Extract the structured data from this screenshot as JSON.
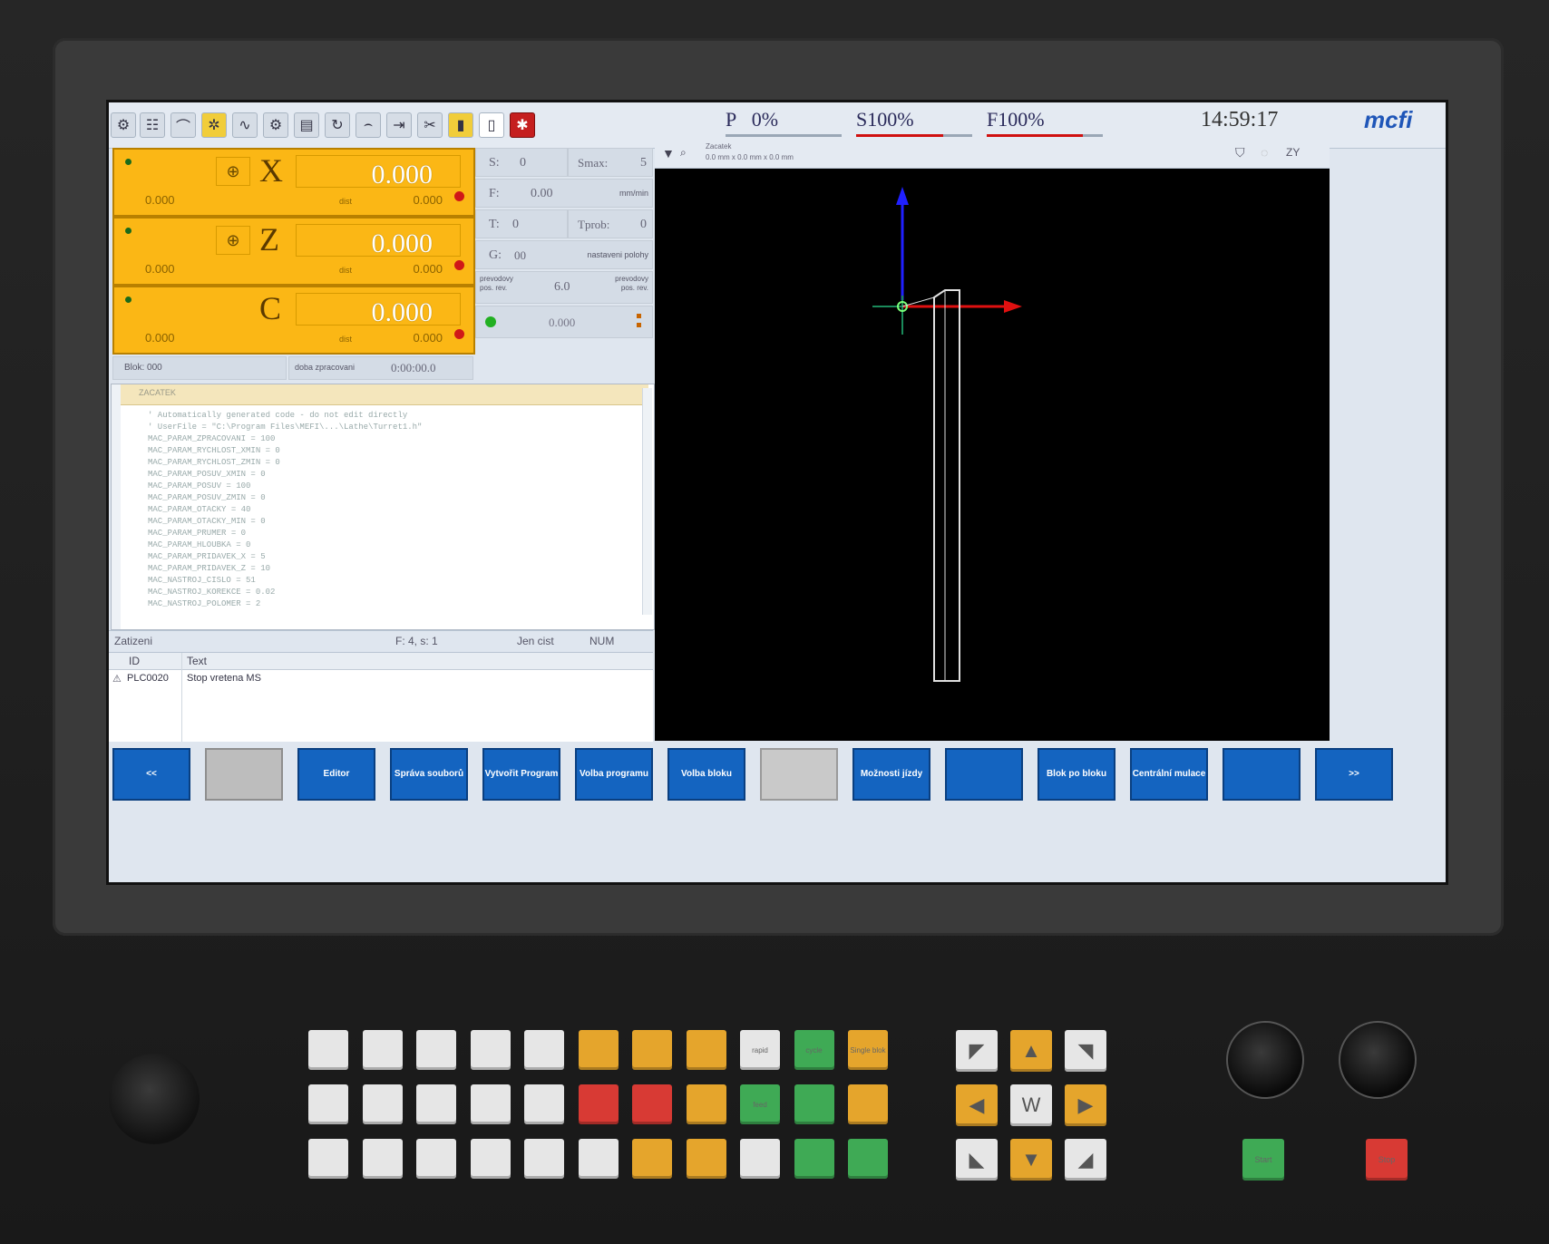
{
  "toolbar": {
    "icons": [
      "settings-icon",
      "settings2-icon",
      "arc-icon",
      "tool-icon",
      "wave-icon",
      "gear-icon",
      "panel-icon",
      "refresh-icon",
      "curve-icon",
      "axis-icon",
      "cut-icon",
      "file-icon",
      "document-icon",
      "emergency-icon"
    ],
    "overrides": {
      "P": {
        "label": "P",
        "value": "0%"
      },
      "S": {
        "label": "S",
        "value": "100%"
      },
      "F": {
        "label": "F",
        "value": "100%"
      }
    },
    "clock": "14:59:17",
    "logo": "mcfi"
  },
  "axes": [
    {
      "name": "X",
      "value": "0.000",
      "sub_left": "0.000",
      "sub_mid": "dist",
      "sub_right": "0.000",
      "has_home_icon": true
    },
    {
      "name": "Z",
      "value": "0.000",
      "sub_left": "0.000",
      "sub_mid": "dist",
      "sub_right": "0.000",
      "has_home_icon": true
    },
    {
      "name": "C",
      "value": "0.000",
      "sub_left": "0.000",
      "sub_mid": "dist",
      "sub_right": "0.000",
      "has_home_icon": false
    }
  ],
  "machine": {
    "S": {
      "label": "S:",
      "value": "0"
    },
    "S_max": {
      "label": "Smax:",
      "value": "5"
    },
    "F": {
      "label": "F:",
      "value": "0.00",
      "unit": "mm/min"
    },
    "T": {
      "label": "T:",
      "value": "0"
    },
    "T_prob": {
      "label": "Tprob:",
      "value": "0"
    },
    "G": {
      "label": "G:",
      "value": "00",
      "desc": "nastaveni polohy"
    },
    "posuv": {
      "left": "prevodovy pos. rev.",
      "value": "6.0",
      "right": "prevodovy pos. rev."
    },
    "progress": "0.000",
    "blok": "Blok: 000",
    "time_label": "doba zpracovani",
    "time_value": "0:00:00.0"
  },
  "editor": {
    "title": "ZACATEK",
    "lines": [
      "' Automatically generated code - do not edit directly",
      "' UserFile = \"C:\\Program Files\\MEFI\\...\\Lathe\\Turret1.h\"",
      "MAC_PARAM_ZPRACOVANI = 100",
      "MAC_PARAM_RYCHLOST_XMIN = 0",
      "MAC_PARAM_RYCHLOST_ZMIN = 0",
      "MAC_PARAM_POSUV_XMIN = 0",
      "MAC_PARAM_POSUV = 100",
      "MAC_PARAM_POSUV_ZMIN = 0",
      "MAC_PARAM_OTACKY = 40",
      "MAC_PARAM_OTACKY_MIN = 0",
      "MAC_PARAM_PRUMER = 0",
      "MAC_PARAM_HLOUBKA = 0",
      "MAC_PARAM_PRIDAVEK_X = 5",
      "MAC_PARAM_PRIDAVEK_Z = 10",
      "MAC_NASTROJ_CISLO = 51",
      "MAC_NASTROJ_KOREKCE = 0.02",
      "MAC_NASTROJ_POLOMER = 2"
    ]
  },
  "status": {
    "mode": "Zatizeni",
    "pos": "F: 4, s: 1",
    "readonly": "Jen cist",
    "num": "NUM"
  },
  "messages": {
    "col_id": "ID",
    "col_text": "Text",
    "rows": [
      {
        "id": "PLC0020",
        "text": "Stop vretena MS"
      }
    ]
  },
  "graphics": {
    "title": "Zacatek",
    "subtitle": "0.0 mm x 0.0 mm x 0.0 mm",
    "zoom": "ZY"
  },
  "softkeys": [
    {
      "label": "<<",
      "style": "blue"
    },
    {
      "label": "",
      "style": "grey"
    },
    {
      "label": "Editor",
      "style": "blue"
    },
    {
      "label": "Správa souborů",
      "style": "blue"
    },
    {
      "label": "Vytvořit Program",
      "style": "blue"
    },
    {
      "label": "Volba programu",
      "style": "blue"
    },
    {
      "label": "Volba bloku",
      "style": "blue"
    },
    {
      "label": "",
      "style": "greyed"
    },
    {
      "label": "Možnosti jízdy",
      "style": "blue"
    },
    {
      "label": "",
      "style": "blue"
    },
    {
      "label": "Blok po bloku",
      "style": "blue"
    },
    {
      "label": "Centrální mulace",
      "style": "blue"
    },
    {
      "label": "",
      "style": "blue"
    },
    {
      "label": ">>",
      "style": "blue"
    }
  ],
  "keypad": {
    "rows": [
      [
        "w",
        "w",
        "w",
        "w",
        "w",
        "o",
        "o",
        "o",
        "w",
        "g",
        "o"
      ],
      [
        "w",
        "w",
        "w",
        "w",
        "w",
        "r",
        "r",
        "o",
        "g",
        "g",
        "o"
      ],
      [
        "w",
        "w",
        "w",
        "w",
        "w",
        "w",
        "o",
        "o",
        "w",
        "g",
        "g"
      ]
    ],
    "labels": {
      "0-8": "rapid",
      "0-9": "cycle",
      "0-10": "Single blok",
      "1-8": "feed"
    }
  },
  "jog": {
    "rows": [
      [
        {
          "c": "w",
          "icon": "arrow-up-left"
        },
        {
          "c": "o",
          "icon": "arrow-up"
        },
        {
          "c": "w",
          "icon": "arrow-up-right"
        }
      ],
      [
        {
          "c": "o",
          "icon": "arrow-left"
        },
        {
          "c": "w",
          "icon": "rapid-w"
        },
        {
          "c": "o",
          "icon": "arrow-right"
        }
      ],
      [
        {
          "c": "w",
          "icon": "arrow-down-left"
        },
        {
          "c": "o",
          "icon": "arrow-down"
        },
        {
          "c": "w",
          "icon": "arrow-down-right"
        }
      ]
    ],
    "center_label": "W"
  },
  "hardware": {
    "start_label": "Start",
    "stop_label": "Stop"
  }
}
